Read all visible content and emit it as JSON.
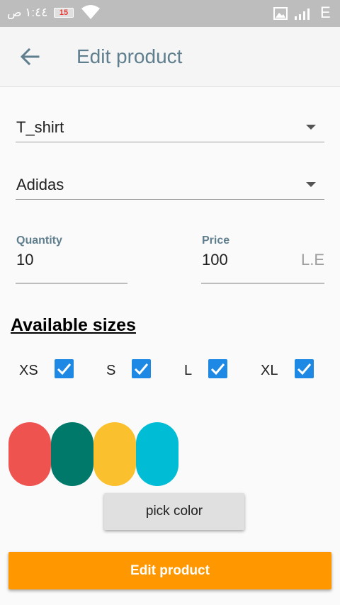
{
  "status_bar": {
    "time": "١:٤٤ ص",
    "battery": "15",
    "network": "E"
  },
  "app_bar": {
    "title": "Edit product",
    "back_icon": "arrow-back-icon"
  },
  "form": {
    "category": {
      "value": "T_shirt"
    },
    "brand": {
      "value": "Adidas"
    },
    "quantity": {
      "label": "Quantity",
      "value": "10"
    },
    "price": {
      "label": "Price",
      "value": "100",
      "suffix": "L.E"
    }
  },
  "sizes": {
    "title": "Available sizes",
    "items": [
      {
        "label": "XS",
        "checked": true
      },
      {
        "label": "S",
        "checked": true
      },
      {
        "label": "L",
        "checked": true
      },
      {
        "label": "XL",
        "checked": true
      }
    ]
  },
  "colors": [
    "#ef5350",
    "#00796b",
    "#fbc02d",
    "#00bcd4"
  ],
  "pick_color_label": "pick color",
  "submit_label": "Edit product",
  "accent": "#ff9800",
  "checkbox_color": "#1e88e5"
}
